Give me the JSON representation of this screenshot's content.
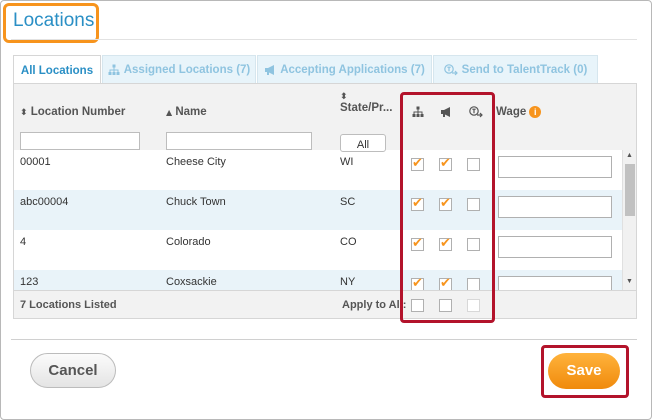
{
  "header": {
    "title": "Locations"
  },
  "tabs": [
    {
      "label": "All Locations",
      "icon": "none"
    },
    {
      "label": "Assigned Locations (7)",
      "icon": "sitemap-icon"
    },
    {
      "label": "Accepting Applications (7)",
      "icon": "megaphone-icon"
    },
    {
      "label": "Send to TalentTrack (0)",
      "icon": "talenttrack-send-icon"
    }
  ],
  "columns": {
    "location_number": "Location Number",
    "name": "Name",
    "state": "State/Pr...",
    "wage": "Wage"
  },
  "filters": {
    "state_button": "All"
  },
  "rows": [
    {
      "number": "00001",
      "name": "Cheese City",
      "state": "WI",
      "assigned": true,
      "accepting": true,
      "send": false,
      "wage": ""
    },
    {
      "number": "abc00004",
      "name": "Chuck Town",
      "state": "SC",
      "assigned": true,
      "accepting": true,
      "send": false,
      "wage": ""
    },
    {
      "number": "4",
      "name": "Colorado",
      "state": "CO",
      "assigned": true,
      "accepting": true,
      "send": false,
      "wage": ""
    },
    {
      "number": "123",
      "name": "Coxsackie",
      "state": "NY",
      "assigned": true,
      "accepting": true,
      "send": false,
      "wage": ""
    }
  ],
  "footer": {
    "count": "7 Locations Listed",
    "apply_label": "Apply to All:"
  },
  "buttons": {
    "cancel": "Cancel",
    "save": "Save"
  },
  "colors": {
    "accent": "#f7941d",
    "link": "#2a8fc5",
    "highlight_border": "#b3132b"
  }
}
